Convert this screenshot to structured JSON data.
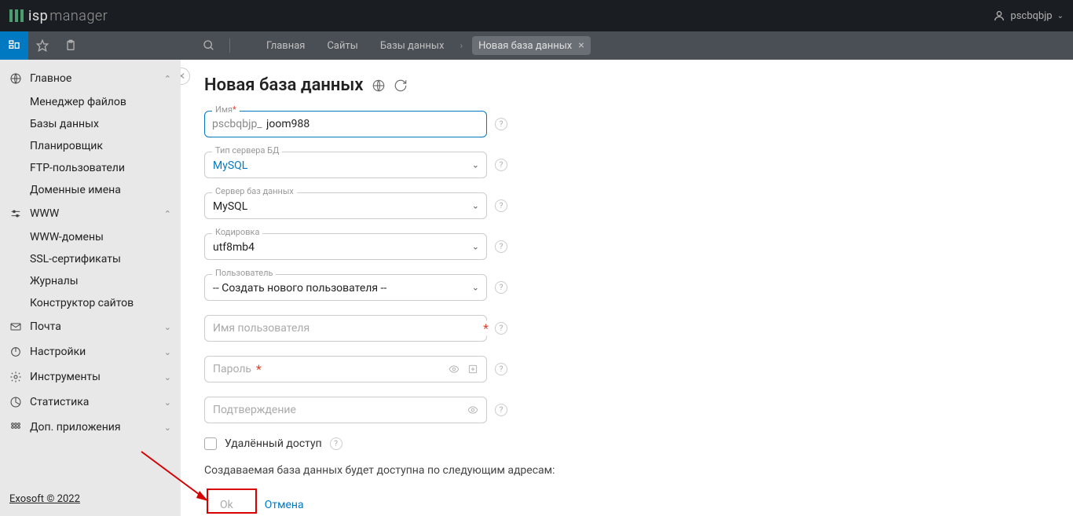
{
  "header": {
    "logo_isp": "isp",
    "logo_rest": "manager",
    "username": "pscbqbjp"
  },
  "breadcrumb": {
    "home": "Главная",
    "sites": "Сайты",
    "databases": "Базы данных",
    "current": "Новая база данных"
  },
  "sidebar": {
    "main": {
      "title": "Главное",
      "items": [
        "Менеджер файлов",
        "Базы данных",
        "Планировщик",
        "FTP-пользователи",
        "Доменные имена"
      ]
    },
    "www": {
      "title": "WWW",
      "items": [
        "WWW-домены",
        "SSL-сертификаты",
        "Журналы",
        "Конструктор сайтов"
      ]
    },
    "mail": {
      "title": "Почта"
    },
    "settings": {
      "title": "Настройки"
    },
    "tools": {
      "title": "Инструменты"
    },
    "stats": {
      "title": "Статистика"
    },
    "apps": {
      "title": "Доп. приложения"
    }
  },
  "footer": "Exosoft © 2022",
  "page": {
    "title": "Новая база данных",
    "name_label": "Имя",
    "name_prefix": "pscbqbjp_",
    "name_value": "joom988",
    "type_label": "Тип сервера БД",
    "type_value": "MySQL",
    "server_label": "Сервер баз данных",
    "server_value": "MySQL",
    "encoding_label": "Кодировка",
    "encoding_value": "utf8mb4",
    "user_label": "Пользователь",
    "user_value": "-- Создать нового пользователя --",
    "username_placeholder": "Имя пользователя",
    "password_placeholder": "Пароль",
    "confirm_placeholder": "Подтверждение",
    "remote_label": "Удалённый доступ",
    "info_text": "Создаваемая база данных будет доступна по следующим адресам:",
    "ok": "Ok",
    "cancel": "Отмена"
  }
}
